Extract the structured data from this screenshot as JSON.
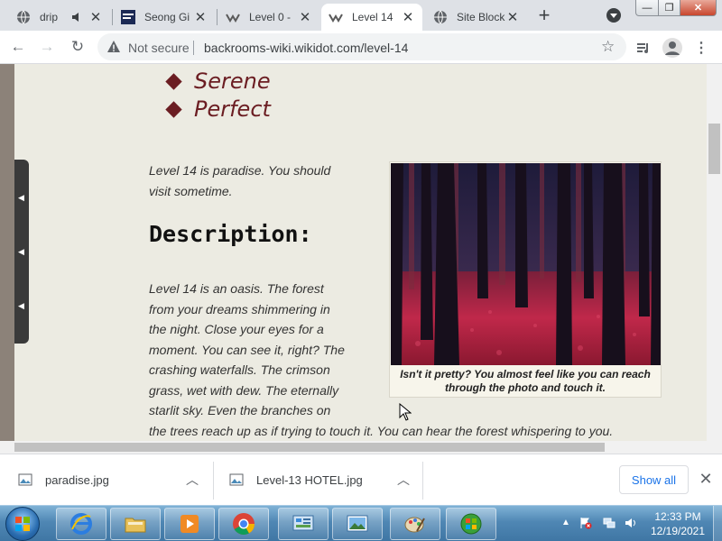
{
  "browser": {
    "tabs": [
      {
        "title": "drip",
        "active": false
      },
      {
        "title": "Seong Gi",
        "active": false
      },
      {
        "title": "Level 0 - ",
        "active": false
      },
      {
        "title": "Level 14",
        "active": true
      },
      {
        "title": "Site Block",
        "active": false
      }
    ],
    "security_label": "Not secure",
    "url": "backrooms-wiki.wikidot.com/level-14"
  },
  "page": {
    "bullets": [
      "Serene",
      "Perfect"
    ],
    "intro_lines": [
      "Level 14 is paradise. You should",
      "visit sometime."
    ],
    "heading": "Description:",
    "description_lines": [
      "Level 14 is an oasis. The forest",
      "from your dreams shimmering in",
      "the night. Close your eyes for a",
      "moment. You can see it, right? The",
      "crashing waterfalls. The crimson",
      "grass, wet with dew. The eternally",
      "starlit sky. Even the branches on",
      "the trees reach up as if trying to touch it. You can hear the forest whispering to you."
    ],
    "figure_caption": "Isn't it pretty? You almost feel like you can reach through the photo and touch it."
  },
  "downloads": {
    "items": [
      {
        "filename": "paradise.jpg"
      },
      {
        "filename": "Level-13 HOTEL.jpg"
      }
    ],
    "show_all_label": "Show all"
  },
  "taskbar": {
    "time": "12:33 PM",
    "date": "12/19/2021"
  },
  "colors": {
    "accent_maroon": "#6b1d22",
    "page_background": "#ecebe2",
    "link_blue": "#1a73e8"
  }
}
